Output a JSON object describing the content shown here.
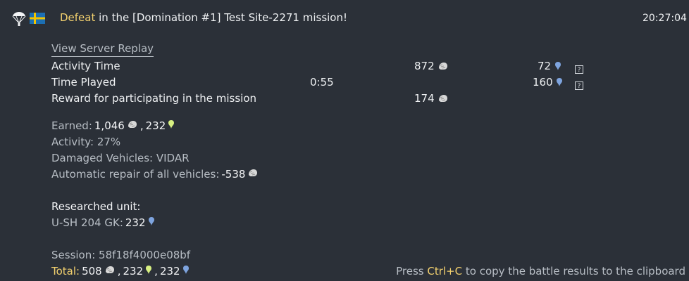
{
  "header": {
    "result_word": "Defeat",
    "mission_text": " in the [Domination #1] Test Site-2271 mission!",
    "timestamp": "20:27:04"
  },
  "replay_link": "View Server Replay",
  "table": {
    "rows": [
      {
        "label": "Activity Time",
        "time": "",
        "sl": "872",
        "rp": "72",
        "has_help": true
      },
      {
        "label": "Time Played",
        "time": "0:55",
        "sl": "",
        "rp": "160",
        "has_help": true
      },
      {
        "label": "Reward for participating in the mission",
        "time": "",
        "sl": "174",
        "rp": "",
        "has_help": false
      }
    ]
  },
  "summary": {
    "earned_label": "Earned: ",
    "earned_sl": "1,046",
    "earned_sep": ", ",
    "earned_crp": "232",
    "activity": "Activity: 27%",
    "damaged": "Damaged Vehicles: VIDAR",
    "repair_label": "Automatic repair of all vehicles: ",
    "repair_value": "-538"
  },
  "research": {
    "title": "Researched unit:",
    "unit_label": "U-SH 204 GK: ",
    "unit_value": "232"
  },
  "session": {
    "text": "Session: 58f18f4000e08bf"
  },
  "total": {
    "label": "Total: ",
    "sl": "508",
    "sep1": ", ",
    "crp": "232",
    "sep2": ", ",
    "rp": "232"
  },
  "footer": {
    "press": "Press ",
    "shortcut": "Ctrl+C",
    "rest": " to copy the battle results to the clipboard"
  },
  "icons": {
    "parachute": "parachute-icon",
    "flag": "sweden-flag-icon",
    "silver_lions": "silver-lions-icon",
    "research_points": "research-points-icon",
    "convertible_rp": "convertible-research-points-icon",
    "help": "help-icon"
  },
  "colors": {
    "background": "#2b3038",
    "yellow": "#f2d06e",
    "muted": "#b7bdc4",
    "blue_rp": "#7ea4df",
    "green_crp": "#d7f082"
  }
}
